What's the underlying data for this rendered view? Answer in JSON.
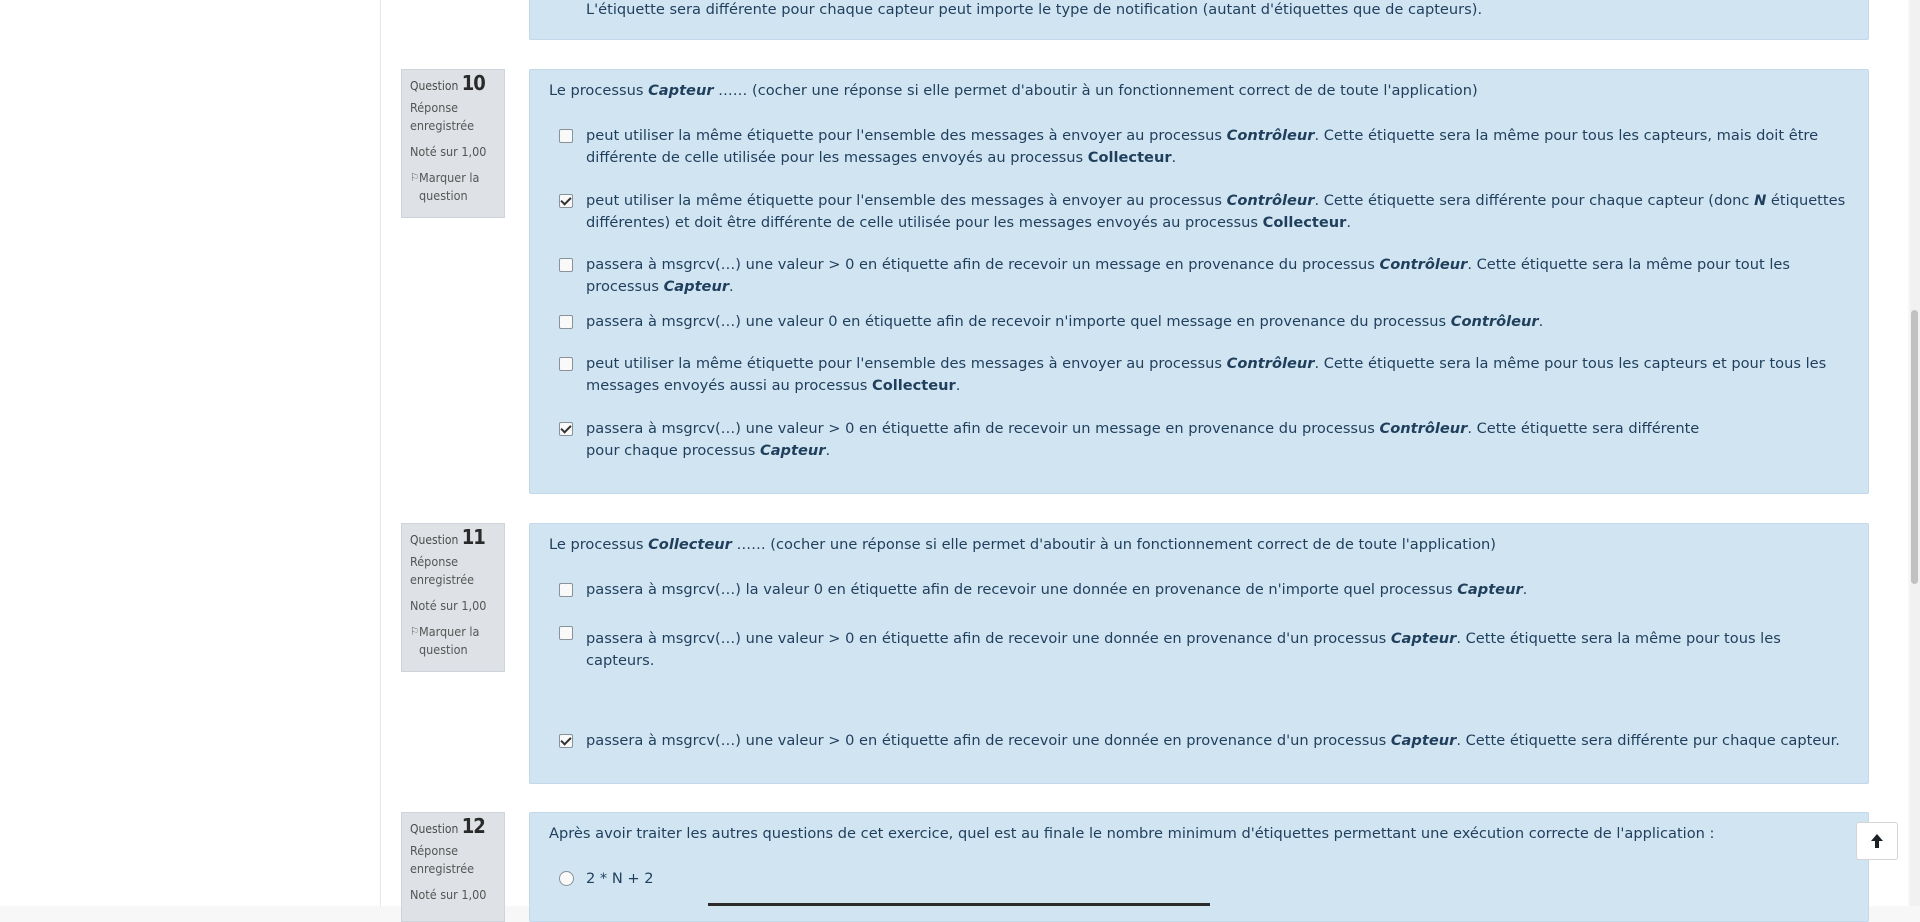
{
  "prev_question": {
    "option_text": "L'étiquette sera différente pour chaque capteur peut importe le type de notification (autant d'étiquettes que de capteurs)."
  },
  "q10": {
    "label": "Question",
    "number": "10",
    "state": "Réponse enregistrée",
    "grade": "Noté sur 1,00",
    "flag": "Marquer la question",
    "text_pre": "Le processus ",
    "text_em": "Capteur",
    "text_post": "  …… (cocher une réponse si elle permet d'aboutir à un fonctionnement  correct de de toute l'application)",
    "options": [
      {
        "a": "peut utiliser la même étiquette pour l'ensemble des messages à envoyer au processus ",
        "b": "Contrôleur",
        "c": ". Cette étiquette sera la même pour tous les capteurs, mais doit être différente de celle utilisée pour les messages envoyés au processus ",
        "d": "Collecteur",
        "e": "."
      },
      {
        "a": "peut utiliser la même étiquette pour l'ensemble des messages à envoyer au processus ",
        "b": "Contrôleur",
        "c": ". Cette étiquette sera différente pour chaque capteur (donc ",
        "d": "N",
        "e": " étiquettes différentes)  et doit être différente de celle utilisée pour les messages envoyés au processus ",
        "f": "Collecteur",
        "g": "."
      },
      {
        "a": "passera à msgrcv(…)  une valeur  > 0  en étiquette afin de recevoir un message en provenance du processus ",
        "b": "Contrôleur",
        "c": ". Cette étiquette sera la même pour tout les processus ",
        "d": "Capteur",
        "e": "."
      },
      {
        "a": "passera à msgrcv(…)  une valeur  0  en étiquette afin de recevoir n'importe quel message en provenance du processus ",
        "b": "Contrôleur",
        "c": "."
      },
      {
        "a": "peut utiliser la même étiquette pour l'ensemble des messages à envoyer au processus ",
        "b": "Contrôleur",
        "c": ". Cette étiquette sera la même pour tous les capteurs et pour tous les messages envoyés aussi au processus ",
        "d": "Collecteur",
        "e": "."
      },
      {
        "a": "passera à msgrcv(…)  une valeur  > 0  en étiquette afin de recevoir un message en provenance du processus ",
        "b": "Contrôleur",
        "c": ". Cette étiquette sera différente pour chaque processus ",
        "d": "Capteur",
        "e": "."
      }
    ],
    "checked": [
      false,
      true,
      false,
      false,
      false,
      true
    ]
  },
  "q11": {
    "label": "Question",
    "number": "11",
    "state": "Réponse enregistrée",
    "grade": "Noté sur 1,00",
    "flag": "Marquer la question",
    "text_pre": "Le processus ",
    "text_em": "Collecteur",
    "text_post": "  …… (cocher une réponse si elle permet d'aboutir à un fonctionnement  correct de de toute l'application)",
    "options": [
      {
        "a": "passera à msgrcv(…) la valeur 0 en étiquette afin de recevoir une donnée en provenance de n'importe quel processus ",
        "b": "Capteur",
        "c": "."
      },
      {
        "a": "passera à msgrcv(…) une valeur > 0 en étiquette afin de recevoir une donnée en provenance d'un processus ",
        "b": "Capteur",
        "c": ". Cette étiquette sera la même pour tous les capteurs."
      },
      {
        "a": "passera à msgrcv(…) une valeur > 0 en étiquette afin de recevoir une donnée en provenance d'un processus ",
        "b": "Capteur",
        "c": ". Cette étiquette sera différente pur chaque capteur."
      }
    ],
    "checked": [
      false,
      false,
      true
    ]
  },
  "q12": {
    "label": "Question",
    "number": "12",
    "state": "Réponse enregistrée",
    "grade": "Noté sur 1,00",
    "text": "Après avoir traiter les autres questions de cet exercice, quel est au finale le nombre minimum d'étiquettes permettant une exécution correcte de l'application :",
    "options": [
      "2 * N + 2"
    ]
  },
  "icons": {
    "flag": "flag-icon",
    "back_to_top": "arrow-up-icon"
  }
}
